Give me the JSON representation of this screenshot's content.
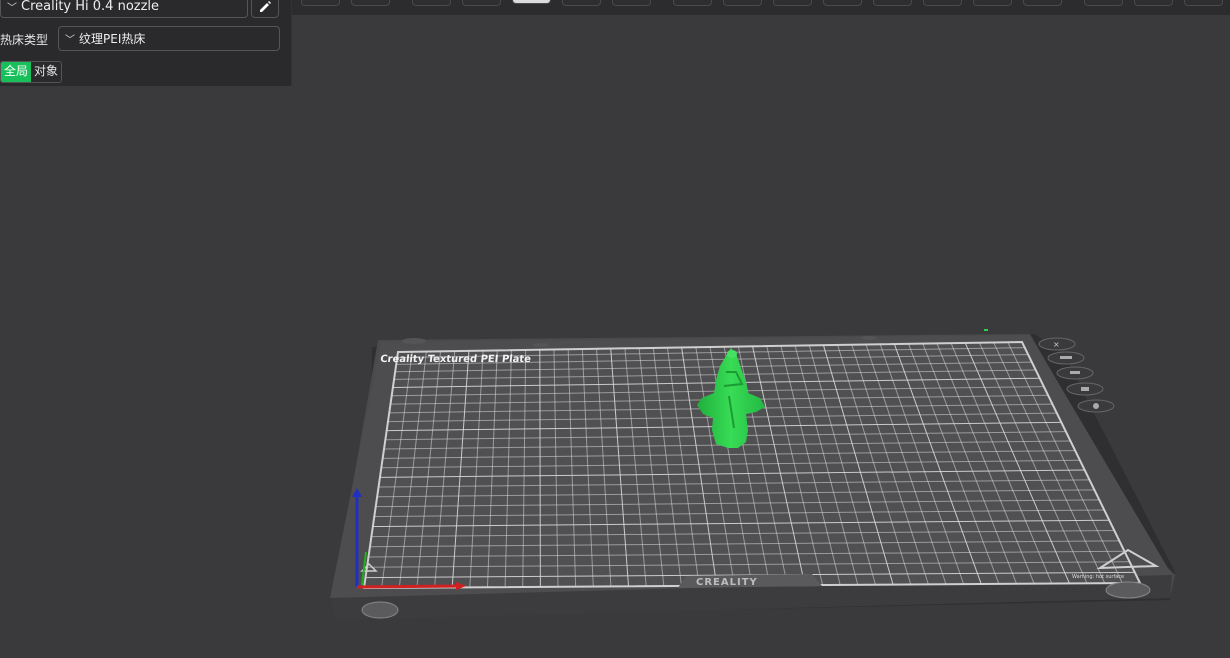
{
  "printer": {
    "name": "Creality Hi 0.4 nozzle",
    "edit_icon": "pencil-icon"
  },
  "bed": {
    "label": "热床类型",
    "value": "纹理PEI热床"
  },
  "tabs": [
    {
      "label": "全局",
      "active": true
    },
    {
      "label": "对象",
      "active": false
    }
  ],
  "plate": {
    "title": "Creality Textured PEI Plate",
    "brand": "CREALITY",
    "corner_text_left": "Warning: hot surface",
    "corner_text_right": "Warning: hot surface"
  },
  "colors": {
    "accent": "#17c05a",
    "background": "#3a3a3c",
    "panel": "#2a2a2c",
    "model": "#2fd24f",
    "axis_x": "#d02020",
    "axis_y": "#20b020",
    "axis_z": "#2030c0"
  },
  "side_icons": [
    "close-icon",
    "list-icon",
    "arrange-icon",
    "lock-icon",
    "settings-icon"
  ]
}
